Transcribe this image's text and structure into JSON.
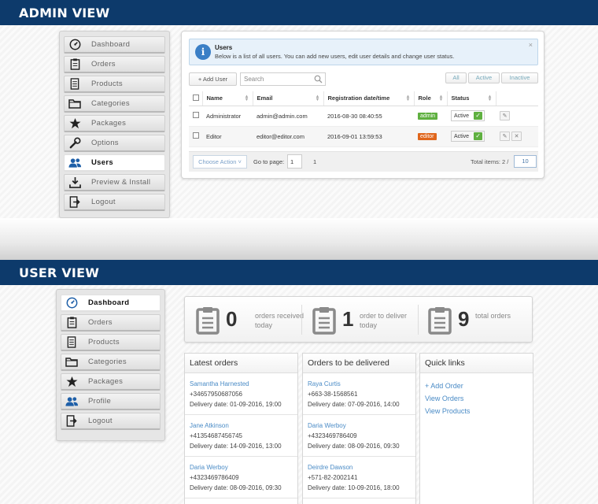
{
  "admin_view": {
    "heading": "ADMIN VIEW",
    "sidebar": [
      {
        "label": "Dashboard",
        "icon": "speedometer-icon",
        "active": false
      },
      {
        "label": "Orders",
        "icon": "clipboard-icon",
        "active": false
      },
      {
        "label": "Products",
        "icon": "document-list-icon",
        "active": false
      },
      {
        "label": "Categories",
        "icon": "folder-icon",
        "active": false
      },
      {
        "label": "Packages",
        "icon": "star-icon",
        "active": false
      },
      {
        "label": "Options",
        "icon": "wrench-icon",
        "active": false
      },
      {
        "label": "Users",
        "icon": "users-icon",
        "active": true
      },
      {
        "label": "Preview & Install",
        "icon": "download-icon",
        "active": false
      },
      {
        "label": "Logout",
        "icon": "logout-icon",
        "active": false
      }
    ],
    "info": {
      "title": "Users",
      "text": "Below is a list of all users. You can add new users, edit user details and change user status.",
      "close": "×"
    },
    "toolbar": {
      "add_user": "+ Add User",
      "search_placeholder": "Search",
      "filter_all": "All",
      "filter_active": "Active",
      "filter_inactive": "Inactive"
    },
    "table": {
      "headers": [
        "Name",
        "Email",
        "Registration date/time",
        "Role",
        "Status"
      ],
      "rows": [
        {
          "name": "Administrator",
          "email": "admin@admin.com",
          "registered": "2016-08-30 08:40:55",
          "role": "admin",
          "role_color": "#5fb040",
          "status": "Active"
        },
        {
          "name": "Editor",
          "email": "editor@editor.com",
          "registered": "2016-09-01 13:59:53",
          "role": "editor",
          "role_color": "#e0661c",
          "status": "Active"
        }
      ]
    },
    "footer": {
      "choose_action": "Choose Action ˅",
      "go_to_page": "Go to page:",
      "page_input": "1",
      "pages": "1",
      "total_items": "Total items: 2 /",
      "per_page": "10"
    }
  },
  "user_view": {
    "heading": "USER VIEW",
    "sidebar": [
      {
        "label": "Dashboard",
        "icon": "speedometer-icon",
        "active": true
      },
      {
        "label": "Orders",
        "icon": "clipboard-icon",
        "active": false
      },
      {
        "label": "Products",
        "icon": "document-list-icon",
        "active": false
      },
      {
        "label": "Categories",
        "icon": "folder-icon",
        "active": false
      },
      {
        "label": "Packages",
        "icon": "star-icon",
        "active": false
      },
      {
        "label": "Profile",
        "icon": "users-icon",
        "active": false
      },
      {
        "label": "Logout",
        "icon": "logout-icon",
        "active": false
      }
    ],
    "stats": [
      {
        "number": "0",
        "line1": "orders received",
        "line2": "today"
      },
      {
        "number": "1",
        "line1": "order to deliver",
        "line2": "today"
      },
      {
        "number": "9",
        "line1": "total orders",
        "line2": ""
      }
    ],
    "latest_orders": {
      "title": "Latest orders",
      "items": [
        {
          "name": "Samantha Harnested",
          "phone": "+34657950687056",
          "delivery": "Delivery date: 01-09-2016, 19:00"
        },
        {
          "name": "Jane Atkinson",
          "phone": "+41354687456745",
          "delivery": "Delivery date: 14-09-2016, 13:00"
        },
        {
          "name": "Daria Werboy",
          "phone": "+4323469786409",
          "delivery": "Delivery date: 08-09-2016, 09:30"
        }
      ]
    },
    "to_deliver": {
      "title": "Orders to be delivered",
      "items": [
        {
          "name": "Raya Curtis",
          "phone": "+663-38-1568561",
          "delivery": "Delivery date: 07-09-2016, 14:00"
        },
        {
          "name": "Daria Werboy",
          "phone": "+4323469786409",
          "delivery": "Delivery date: 08-09-2016, 09:30"
        },
        {
          "name": "Deirdre Dawson",
          "phone": "+571-82-2002141",
          "delivery": "Delivery date: 10-09-2016, 18:00"
        }
      ]
    },
    "quick_links": {
      "title": "Quick links",
      "links": [
        "+ Add Order",
        "View Orders",
        "View Products"
      ]
    }
  }
}
